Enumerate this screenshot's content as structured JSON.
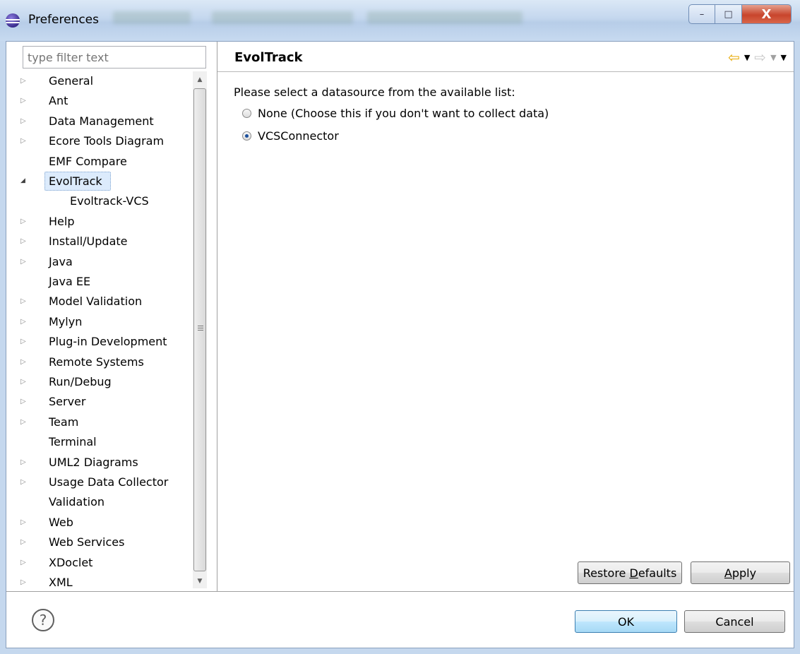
{
  "window": {
    "title": "Preferences"
  },
  "window_controls": {
    "minimize": "–",
    "maximize": "□",
    "close": "X"
  },
  "filter": {
    "placeholder": "type filter text"
  },
  "tree": {
    "items": [
      {
        "label": "General",
        "expandable": true
      },
      {
        "label": "Ant",
        "expandable": true
      },
      {
        "label": "Data Management",
        "expandable": true
      },
      {
        "label": "Ecore Tools Diagram",
        "expandable": true
      },
      {
        "label": "EMF Compare",
        "expandable": false
      },
      {
        "label": "EvolTrack",
        "expandable": true,
        "expanded": true,
        "selected": true
      },
      {
        "label": "Evoltrack-VCS",
        "expandable": false,
        "child": true
      },
      {
        "label": "Help",
        "expandable": true
      },
      {
        "label": "Install/Update",
        "expandable": true
      },
      {
        "label": "Java",
        "expandable": true
      },
      {
        "label": "Java EE",
        "expandable": false
      },
      {
        "label": "Model Validation",
        "expandable": true
      },
      {
        "label": "Mylyn",
        "expandable": true
      },
      {
        "label": "Plug-in Development",
        "expandable": true
      },
      {
        "label": "Remote Systems",
        "expandable": true
      },
      {
        "label": "Run/Debug",
        "expandable": true
      },
      {
        "label": "Server",
        "expandable": true
      },
      {
        "label": "Team",
        "expandable": true
      },
      {
        "label": "Terminal",
        "expandable": false
      },
      {
        "label": "UML2 Diagrams",
        "expandable": true
      },
      {
        "label": "Usage Data Collector",
        "expandable": true
      },
      {
        "label": "Validation",
        "expandable": false
      },
      {
        "label": "Web",
        "expandable": true
      },
      {
        "label": "Web Services",
        "expandable": true
      },
      {
        "label": "XDoclet",
        "expandable": true
      },
      {
        "label": "XML",
        "expandable": true
      }
    ]
  },
  "page": {
    "title": "EvolTrack",
    "instruction": "Please select a datasource from the available list:",
    "options": [
      {
        "label": "None (Choose this if you don't want to collect data)",
        "selected": false
      },
      {
        "label": "VCSConnector",
        "selected": true
      }
    ]
  },
  "buttons": {
    "restore_defaults_pre": "Restore ",
    "restore_defaults_mnemonic": "D",
    "restore_defaults_post": "efaults",
    "apply_mnemonic": "A",
    "apply_post": "pply",
    "ok": "OK",
    "cancel": "Cancel"
  },
  "colors": {
    "nav_back": "#e7a800",
    "selection": "#dcebfc",
    "ok_border": "#3c7fb1"
  }
}
